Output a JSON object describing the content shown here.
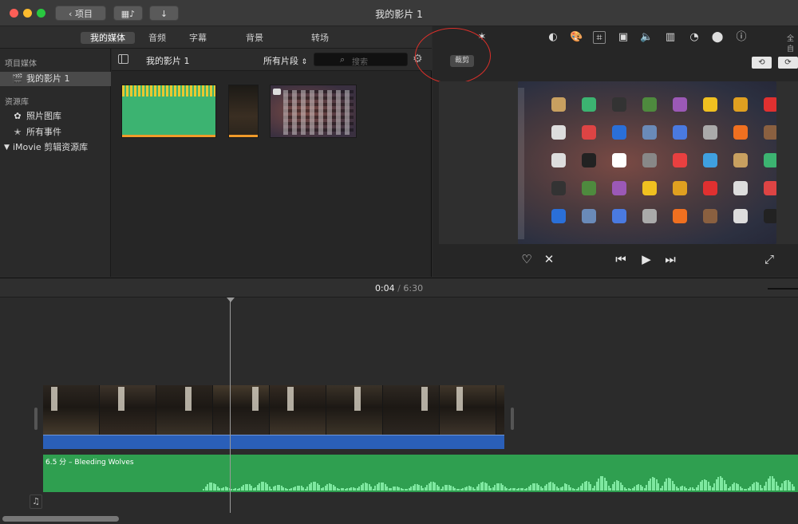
{
  "window": {
    "title": "我的影片 1",
    "back_label": "项目"
  },
  "tabs": [
    "我的媒体",
    "音频",
    "字幕",
    "背景",
    "转场"
  ],
  "sidebar": {
    "section1": "项目媒体",
    "project_item": "我的影片 1",
    "section2": "资源库",
    "photos": "照片图库",
    "events": "所有事件",
    "library": "iMovie 剪辑资源库"
  },
  "browser": {
    "title": "我的影片 1",
    "filter": "所有片段",
    "search_placeholder": "搜索"
  },
  "viewer": {
    "crop_label": "裁剪",
    "fullscreen_partial": "全自"
  },
  "timeline": {
    "current": "0:04",
    "separator": "/",
    "total": "6:30",
    "music_label": "6.5 分 –  Bleeding Wolves"
  },
  "colors": {
    "annotation": "#d9302a",
    "video_audio": "#2a5fb8",
    "music_track": "#2f9f50",
    "clip_green": "#3cb371"
  }
}
